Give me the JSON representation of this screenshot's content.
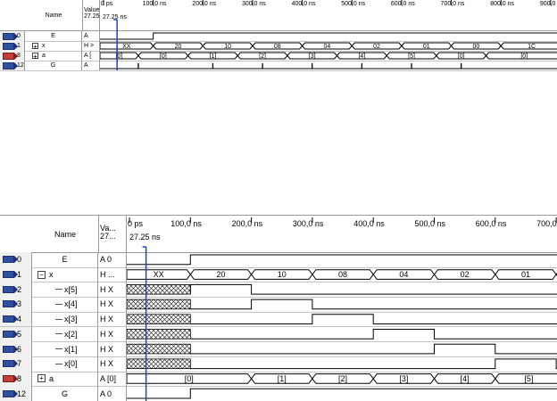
{
  "top_panel": {
    "header": {
      "name_label": "Name",
      "value_label": "Value",
      "value_sub": "27.25",
      "cursor_label": "27.25 ns",
      "ticks": [
        "0 ps",
        "100,0 ns",
        "200,0 ns",
        "300,0 ns",
        "400,0 ns",
        "500,0 ns",
        "600,0 ns",
        "700,0 ns",
        "800,0 ns",
        "900,0 ns"
      ]
    },
    "rows": [
      {
        "index": "0",
        "name": "E",
        "value": "A",
        "kind": "pin",
        "expander": ""
      },
      {
        "index": "1",
        "name": "x",
        "value": "H >",
        "kind": "pin",
        "expander": "+"
      },
      {
        "index": "8",
        "name": "a",
        "value": "A [",
        "kind": "bus",
        "expander": "+"
      },
      {
        "index": "12",
        "name": "G",
        "value": "A",
        "kind": "pin",
        "expander": ""
      }
    ],
    "x_segments": [
      "XX",
      "20",
      "10",
      "08",
      "04",
      "02",
      "01",
      "00",
      "1C"
    ],
    "a_segments": [
      "[0]",
      "[0]",
      "[1]",
      "[2]",
      "[3]",
      "[4]",
      "[5]",
      "[0]",
      "[0]"
    ]
  },
  "bottom_panel": {
    "header": {
      "name_label": "Name",
      "value_label": "Va...",
      "value_sub": "27...",
      "cursor_label": "27.25 ns",
      "ticks": [
        "0 ps",
        "100,0 ns",
        "200,0 ns",
        "300,0 ns",
        "400,0 ns",
        "500,0 ns",
        "600,0 ns",
        "700,0"
      ]
    },
    "rows": [
      {
        "index": "0",
        "name": "E",
        "value": "A 0",
        "kind": "pin",
        "expander": ""
      },
      {
        "index": "1",
        "name": "x",
        "value": "H ...",
        "kind": "pin",
        "expander": "-"
      },
      {
        "index": "2",
        "name": "x[5]",
        "value": "H X",
        "kind": "pin",
        "expander": ""
      },
      {
        "index": "3",
        "name": "x[4]",
        "value": "H X",
        "kind": "pin",
        "expander": ""
      },
      {
        "index": "4",
        "name": "x[3]",
        "value": "H X",
        "kind": "pin",
        "expander": ""
      },
      {
        "index": "5",
        "name": "x[2]",
        "value": "H X",
        "kind": "pin",
        "expander": ""
      },
      {
        "index": "6",
        "name": "x[1]",
        "value": "H X",
        "kind": "pin",
        "expander": ""
      },
      {
        "index": "7",
        "name": "x[0]",
        "value": "H X",
        "kind": "pin",
        "expander": ""
      },
      {
        "index": "8",
        "name": "a",
        "value": "A [0]",
        "kind": "bus",
        "expander": "+"
      },
      {
        "index": "12",
        "name": "G",
        "value": "A 0",
        "kind": "pin",
        "expander": ""
      }
    ],
    "x_segments": [
      "XX",
      "20",
      "10",
      "08",
      "04",
      "02",
      "01"
    ],
    "a_segments": [
      "[0]",
      "[1]",
      "[2]",
      "[3]",
      "[4]",
      "[5]"
    ]
  },
  "colors": {
    "waveform": "#000000",
    "cursor": "#1f3fd0",
    "grid": "#c4c4c4",
    "bus_pin": "#c43d3d",
    "input_pin": "#2f4fa0"
  }
}
